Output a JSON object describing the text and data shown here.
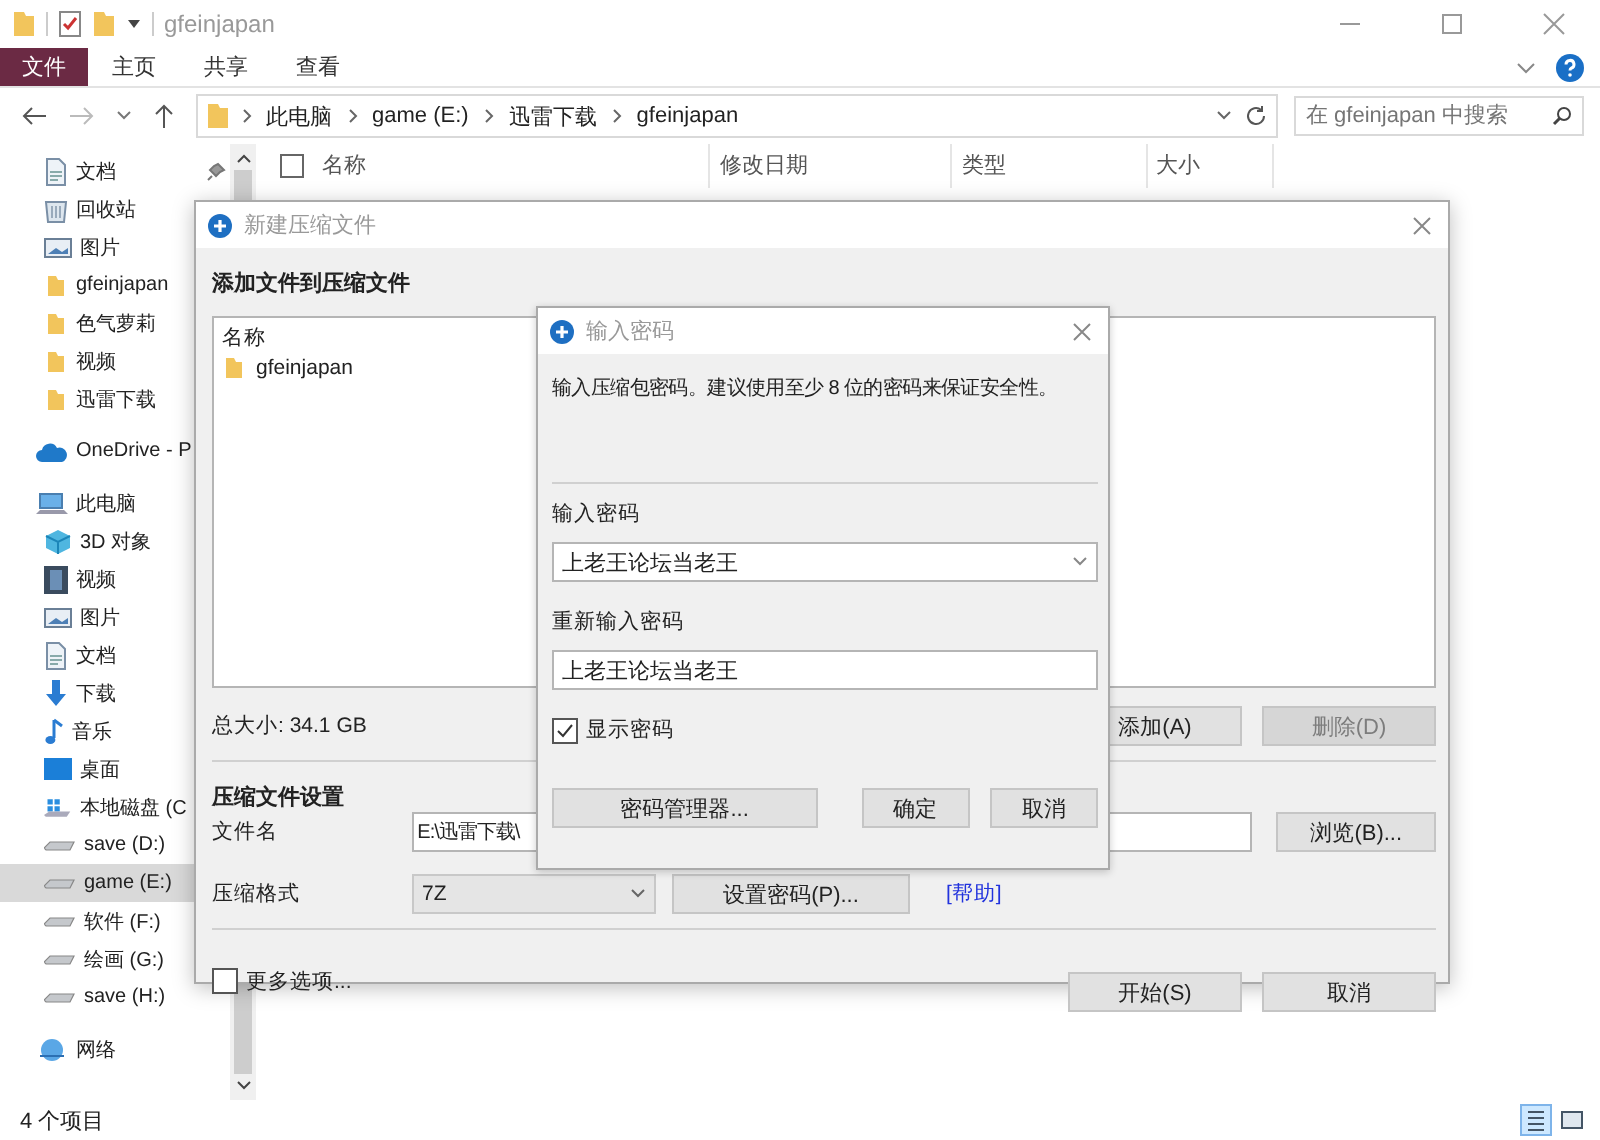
{
  "explorer": {
    "title": "gfeinjapan",
    "ribbon_tabs": [
      {
        "label": "文件",
        "selected": true
      },
      {
        "label": "主页",
        "selected": false
      },
      {
        "label": "共享",
        "selected": false
      },
      {
        "label": "查看",
        "selected": false
      }
    ],
    "breadcrumb": [
      "此电脑",
      "game (E:)",
      "迅雷下载",
      "gfeinjapan"
    ],
    "search": {
      "placeholder": "在 gfeinjapan 中搜索"
    },
    "sidebar": {
      "items": [
        {
          "label": "文档",
          "kind": "document",
          "pinned": true,
          "selected": false
        },
        {
          "label": "回收站",
          "kind": "recycle",
          "selected": false
        },
        {
          "label": "图片",
          "kind": "picture",
          "selected": false
        },
        {
          "label": "gfeinjapan",
          "kind": "folder",
          "selected": false
        },
        {
          "label": "色气萝莉",
          "kind": "folder",
          "selected": false
        },
        {
          "label": "视频",
          "kind": "folder",
          "selected": false
        },
        {
          "label": "迅雷下载",
          "kind": "folder",
          "selected": false
        },
        {
          "label": "OneDrive - P",
          "kind": "cloud",
          "selected": false
        },
        {
          "label": "此电脑",
          "kind": "computer",
          "selected": false,
          "children": [
            {
              "label": "3D 对象",
              "kind": "cube",
              "selected": false
            },
            {
              "label": "视频",
              "kind": "video",
              "selected": false
            },
            {
              "label": "图片",
              "kind": "picture",
              "selected": false
            },
            {
              "label": "文档",
              "kind": "document",
              "selected": false
            },
            {
              "label": "下载",
              "kind": "download",
              "selected": false
            },
            {
              "label": "音乐",
              "kind": "music",
              "selected": false
            },
            {
              "label": "桌面",
              "kind": "desktop",
              "selected": false
            },
            {
              "label": "本地磁盘 (C",
              "kind": "system-drive",
              "selected": false
            },
            {
              "label": "save (D:)",
              "kind": "drive",
              "selected": false
            },
            {
              "label": "game (E:)",
              "kind": "drive",
              "selected": true
            },
            {
              "label": "软件 (F:)",
              "kind": "drive",
              "selected": false
            },
            {
              "label": "绘画 (G:)",
              "kind": "drive",
              "selected": false
            },
            {
              "label": "save (H:)",
              "kind": "drive",
              "selected": false
            }
          ]
        },
        {
          "label": "网络",
          "kind": "network",
          "selected": false
        }
      ]
    },
    "select_all": {
      "checked": false
    },
    "columns": [
      "名称",
      "修改日期",
      "类型",
      "大小"
    ],
    "status_bar": "4 个项目"
  },
  "archive_dialog": {
    "title": "新建压缩文件",
    "section_add": "添加文件到压缩文件",
    "list_header": "名称",
    "files": [
      {
        "name": "gfeinjapan"
      }
    ],
    "total_size": "总大小: 34.1 GB",
    "list_buttons": [
      {
        "label": "添加(A)",
        "disabled": false
      },
      {
        "label": "删除(D)",
        "disabled": true
      }
    ],
    "section_settings": "压缩文件设置",
    "filename_label": "文件名",
    "filename_value": "E:\\迅雷下载\\",
    "browse": "浏览(B)...",
    "format_label": "压缩格式",
    "format_value": "7Z",
    "set_password": "设置密码(P)...",
    "help_link": "[帮助]",
    "more_options": {
      "label": "更多选项...",
      "checked": false
    },
    "buttons": [
      "开始(S)",
      "取消"
    ]
  },
  "password_dialog": {
    "title": "输入密码",
    "hint": "输入压缩包密码。建议使用至少 8 位的密码来保证安全性。",
    "password_label": "输入密码",
    "password_value": "上老王论坛当老王",
    "confirm_label": "重新输入密码",
    "confirm_value": "上老王论坛当老王",
    "show_password": {
      "label": "显示密码",
      "checked": true
    },
    "buttons": [
      "密码管理器...",
      "确定",
      "取消"
    ]
  }
}
